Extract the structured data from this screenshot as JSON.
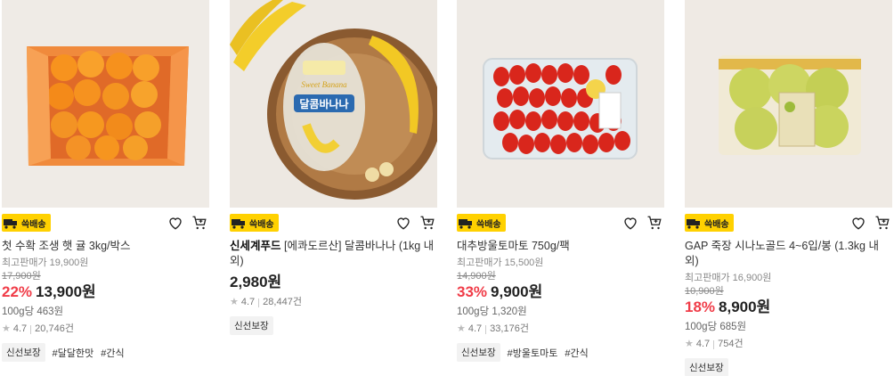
{
  "badge_label": "쓱배송",
  "products": [
    {
      "brand": "",
      "title": "첫 수확 조생 햇 귤 3kg/박스",
      "orig_label": "최고판매가 19,900원",
      "strike": "17,900원",
      "discount": "22%",
      "price": "13,900원",
      "unit": "100g당 463원",
      "rating": "4.7",
      "reviews": "20,746건",
      "chip": "신선보장",
      "tags": [
        "#달달한맛",
        "#간식"
      ]
    },
    {
      "brand": "신세계푸드",
      "title": "[에콰도르산] 달콤바나나 (1kg 내외)",
      "orig_label": "",
      "strike": "",
      "discount": "",
      "price": "2,980원",
      "unit": "",
      "rating": "4.7",
      "reviews": "28,447건",
      "chip": "신선보장",
      "tags": []
    },
    {
      "brand": "",
      "title": "대추방울토마토 750g/팩",
      "orig_label": "최고판매가 15,500원",
      "strike": "14,900원",
      "discount": "33%",
      "price": "9,900원",
      "unit": "100g당 1,320원",
      "rating": "4.7",
      "reviews": "33,176건",
      "chip": "신선보장",
      "tags": [
        "#방울토마토",
        "#간식"
      ]
    },
    {
      "brand": "",
      "title": "GAP 죽장 시나노골드 4~6입/봉 (1.3kg 내외)",
      "orig_label": "최고판매가 16,900원",
      "strike": "10,900원",
      "discount": "18%",
      "price": "8,900원",
      "unit": "100g당 685원",
      "rating": "4.7",
      "reviews": "754건",
      "chip": "신선보장",
      "tags": []
    }
  ],
  "image_text": {
    "banana_bag_script": "Sweet Banana",
    "banana_bag_label": "달콤바나나"
  }
}
